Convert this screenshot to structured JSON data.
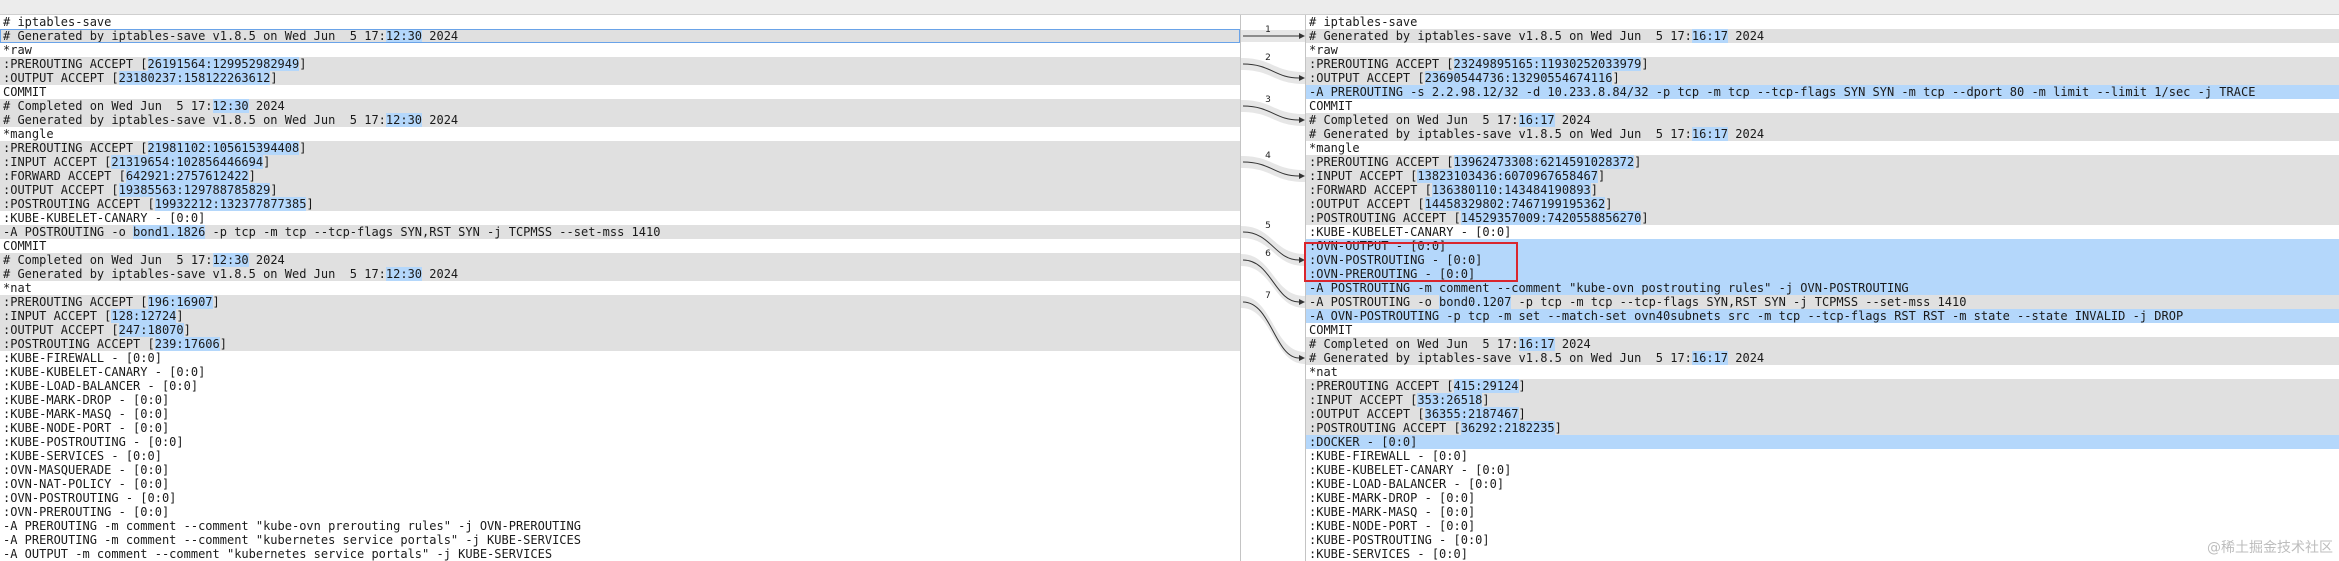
{
  "left": {
    "lines": [
      {
        "segs": [
          "# iptables-save"
        ]
      },
      {
        "t": "changed",
        "focused": true,
        "segs": [
          "# Generated by iptables-save v1.8.5 on Wed Jun  5 17:",
          {
            "h": "12:30"
          },
          " 2024"
        ]
      },
      {
        "segs": [
          "*raw"
        ]
      },
      {
        "t": "changed",
        "segs": [
          ":PREROUTING ACCEPT [",
          {
            "h": "26191564:129952982949"
          },
          "]"
        ]
      },
      {
        "t": "changed",
        "segs": [
          ":OUTPUT ACCEPT [",
          {
            "h": "23180237:158122263612"
          },
          "]"
        ]
      },
      {
        "segs": [
          "COMMIT"
        ]
      },
      {
        "t": "changed",
        "segs": [
          "# Completed on Wed Jun  5 17:",
          {
            "h": "12:30"
          },
          " 2024"
        ]
      },
      {
        "t": "changed",
        "segs": [
          "# Generated by iptables-save v1.8.5 on Wed Jun  5 17:",
          {
            "h": "12:30"
          },
          " 2024"
        ]
      },
      {
        "segs": [
          "*mangle"
        ]
      },
      {
        "t": "changed",
        "segs": [
          ":PREROUTING ACCEPT [",
          {
            "h": "21981102:105615394408"
          },
          "]"
        ]
      },
      {
        "t": "changed",
        "segs": [
          ":INPUT ACCEPT [",
          {
            "h": "21319654:102856446694"
          },
          "]"
        ]
      },
      {
        "t": "changed",
        "segs": [
          ":FORWARD ACCEPT [",
          {
            "h": "642921:2757612422"
          },
          "]"
        ]
      },
      {
        "t": "changed",
        "segs": [
          ":OUTPUT ACCEPT [",
          {
            "h": "19385563:129788785829"
          },
          "]"
        ]
      },
      {
        "t": "changed",
        "segs": [
          ":POSTROUTING ACCEPT [",
          {
            "h": "19932212:132377877385"
          },
          "]"
        ]
      },
      {
        "segs": [
          ":KUBE-KUBELET-CANARY - [0:0]"
        ]
      },
      {
        "t": "changed",
        "segs": [
          "-A POSTROUTING -o ",
          {
            "h": "bond1.1826"
          },
          " -p tcp -m tcp --tcp-flags SYN,RST SYN -j TCPMSS --set-mss 1410"
        ]
      },
      {
        "segs": [
          "COMMIT"
        ]
      },
      {
        "t": "changed",
        "segs": [
          "# Completed on Wed Jun  5 17:",
          {
            "h": "12:30"
          },
          " 2024"
        ]
      },
      {
        "t": "changed",
        "segs": [
          "# Generated by iptables-save v1.8.5 on Wed Jun  5 17:",
          {
            "h": "12:30"
          },
          " 2024"
        ]
      },
      {
        "segs": [
          "*nat"
        ]
      },
      {
        "t": "changed",
        "segs": [
          ":PREROUTING ACCEPT [",
          {
            "h": "196:16907"
          },
          "]"
        ]
      },
      {
        "t": "changed",
        "segs": [
          ":INPUT ACCEPT [",
          {
            "h": "128:12724"
          },
          "]"
        ]
      },
      {
        "t": "changed",
        "segs": [
          ":OUTPUT ACCEPT [",
          {
            "h": "247:18070"
          },
          "]"
        ]
      },
      {
        "t": "changed",
        "segs": [
          ":POSTROUTING ACCEPT [",
          {
            "h": "239:17606"
          },
          "]"
        ]
      },
      {
        "segs": [
          ":KUBE-FIREWALL - [0:0]"
        ]
      },
      {
        "segs": [
          ":KUBE-KUBELET-CANARY - [0:0]"
        ]
      },
      {
        "segs": [
          ":KUBE-LOAD-BALANCER - [0:0]"
        ]
      },
      {
        "segs": [
          ":KUBE-MARK-DROP - [0:0]"
        ]
      },
      {
        "segs": [
          ":KUBE-MARK-MASQ - [0:0]"
        ]
      },
      {
        "segs": [
          ":KUBE-NODE-PORT - [0:0]"
        ]
      },
      {
        "segs": [
          ":KUBE-POSTROUTING - [0:0]"
        ]
      },
      {
        "segs": [
          ":KUBE-SERVICES - [0:0]"
        ]
      },
      {
        "segs": [
          ":OVN-MASQUERADE - [0:0]"
        ]
      },
      {
        "segs": [
          ":OVN-NAT-POLICY - [0:0]"
        ]
      },
      {
        "segs": [
          ":OVN-POSTROUTING - [0:0]"
        ]
      },
      {
        "segs": [
          ":OVN-PREROUTING - [0:0]"
        ]
      },
      {
        "segs": [
          "-A PREROUTING -m comment --comment \"kube-ovn prerouting rules\" -j OVN-PREROUTING"
        ]
      },
      {
        "segs": [
          "-A PREROUTING -m comment --comment \"kubernetes service portals\" -j KUBE-SERVICES"
        ]
      },
      {
        "segs": [
          "-A OUTPUT -m comment --comment \"kubernetes service portals\" -j KUBE-SERVICES"
        ]
      }
    ]
  },
  "right": {
    "lines": [
      {
        "segs": [
          "# iptables-save"
        ]
      },
      {
        "t": "changed",
        "segs": [
          "# Generated by iptables-save v1.8.5 on Wed Jun  5 17:",
          {
            "h": "16:17"
          },
          " 2024"
        ]
      },
      {
        "segs": [
          "*raw"
        ]
      },
      {
        "t": "changed",
        "segs": [
          ":PREROUTING ACCEPT [",
          {
            "h": "23249895165:11930252033979"
          },
          "]"
        ]
      },
      {
        "t": "changed",
        "segs": [
          ":OUTPUT ACCEPT [",
          {
            "h": "23690544736:13290554674116"
          },
          "]"
        ]
      },
      {
        "t": "added",
        "segs": [
          "-A PREROUTING -s 2.2.98.12/32 -d 10.233.8.84/32 -p tcp -m tcp --tcp-flags SYN SYN -m tcp --dport 80 -m limit --limit 1/sec -j TRACE"
        ]
      },
      {
        "segs": [
          "COMMIT"
        ]
      },
      {
        "t": "changed",
        "segs": [
          "# Completed on Wed Jun  5 17:",
          {
            "h": "16:17"
          },
          " 2024"
        ]
      },
      {
        "t": "changed",
        "segs": [
          "# Generated by iptables-save v1.8.5 on Wed Jun  5 17:",
          {
            "h": "16:17"
          },
          " 2024"
        ]
      },
      {
        "segs": [
          "*mangle"
        ]
      },
      {
        "t": "changed",
        "segs": [
          ":PREROUTING ACCEPT [",
          {
            "h": "13962473308:6214591028372"
          },
          "]"
        ]
      },
      {
        "t": "changed",
        "segs": [
          ":INPUT ACCEPT [",
          {
            "h": "13823103436:6070967658467"
          },
          "]"
        ]
      },
      {
        "t": "changed",
        "segs": [
          ":FORWARD ACCEPT [",
          {
            "h": "136380110:143484190893"
          },
          "]"
        ]
      },
      {
        "t": "changed",
        "segs": [
          ":OUTPUT ACCEPT [",
          {
            "h": "14458329802:7467199195362"
          },
          "]"
        ]
      },
      {
        "t": "changed",
        "segs": [
          ":POSTROUTING ACCEPT [",
          {
            "h": "14529357009:7420558856270"
          },
          "]"
        ]
      },
      {
        "segs": [
          ":KUBE-KUBELET-CANARY - [0:0]"
        ]
      },
      {
        "t": "added",
        "segs": [
          ":OVN-OUTPUT - [0:0]"
        ]
      },
      {
        "t": "added",
        "segs": [
          ":OVN-POSTROUTING - [0:0]"
        ]
      },
      {
        "t": "added",
        "segs": [
          ":OVN-PREROUTING - [0:0]"
        ]
      },
      {
        "t": "added",
        "segs": [
          "-A POSTROUTING -m comment --comment \"kube-ovn postrouting rules\" -j OVN-POSTROUTING"
        ]
      },
      {
        "t": "changed",
        "segs": [
          "-A POSTROUTING -o ",
          {
            "h": "bond0.1207"
          },
          " -p tcp -m tcp --tcp-flags SYN,RST SYN -j TCPMSS --set-mss 1410"
        ]
      },
      {
        "t": "added",
        "segs": [
          "-A OVN-POSTROUTING -p tcp -m set --match-set ovn40subnets src -m tcp --tcp-flags RST RST -m state --state INVALID -j DROP"
        ]
      },
      {
        "segs": [
          "COMMIT"
        ]
      },
      {
        "t": "changed",
        "segs": [
          "# Completed on Wed Jun  5 17:",
          {
            "h": "16:17"
          },
          " 2024"
        ]
      },
      {
        "t": "changed",
        "segs": [
          "# Generated by iptables-save v1.8.5 on Wed Jun  5 17:",
          {
            "h": "16:17"
          },
          " 2024"
        ]
      },
      {
        "segs": [
          "*nat"
        ]
      },
      {
        "t": "changed",
        "segs": [
          ":PREROUTING ACCEPT [",
          {
            "h": "415:29124"
          },
          "]"
        ]
      },
      {
        "t": "changed",
        "segs": [
          ":INPUT ACCEPT [",
          {
            "h": "353:26518"
          },
          "]"
        ]
      },
      {
        "t": "changed",
        "segs": [
          ":OUTPUT ACCEPT [",
          {
            "h": "36355:2187467"
          },
          "]"
        ]
      },
      {
        "t": "changed",
        "segs": [
          ":POSTROUTING ACCEPT [",
          {
            "h": "36292:2182235"
          },
          "]"
        ]
      },
      {
        "t": "added",
        "segs": [
          ":DOCKER - [0:0]"
        ]
      },
      {
        "segs": [
          ":KUBE-FIREWALL - [0:0]"
        ]
      },
      {
        "segs": [
          ":KUBE-KUBELET-CANARY - [0:0]"
        ]
      },
      {
        "segs": [
          ":KUBE-LOAD-BALANCER - [0:0]"
        ]
      },
      {
        "segs": [
          ":KUBE-MARK-DROP - [0:0]"
        ]
      },
      {
        "segs": [
          ":KUBE-MARK-MASQ - [0:0]"
        ]
      },
      {
        "segs": [
          ":KUBE-NODE-PORT - [0:0]"
        ]
      },
      {
        "segs": [
          ":KUBE-POSTROUTING - [0:0]"
        ]
      },
      {
        "segs": [
          ":KUBE-SERVICES - [0:0]"
        ]
      }
    ]
  },
  "markers": [
    {
      "label": "1",
      "leftLine": 1,
      "rightLine": 1
    },
    {
      "label": "2",
      "leftLine": 3,
      "rightLine": 4
    },
    {
      "label": "3",
      "leftLine": 6,
      "rightLine": 7
    },
    {
      "label": "4",
      "leftLine": 10,
      "rightLine": 11
    },
    {
      "label": "5",
      "leftLine": 15,
      "rightLine": 17
    },
    {
      "label": "6",
      "leftLine": 17,
      "rightLine": 20
    },
    {
      "label": "7",
      "leftLine": 20,
      "rightLine": 24
    }
  ],
  "watermark": "@稀土掘金技术社区",
  "colors": {
    "changed": "#e0e0e0",
    "added": "#b4d7fb",
    "highlight": "#b4d7fb",
    "annotation": "#d9262e"
  }
}
